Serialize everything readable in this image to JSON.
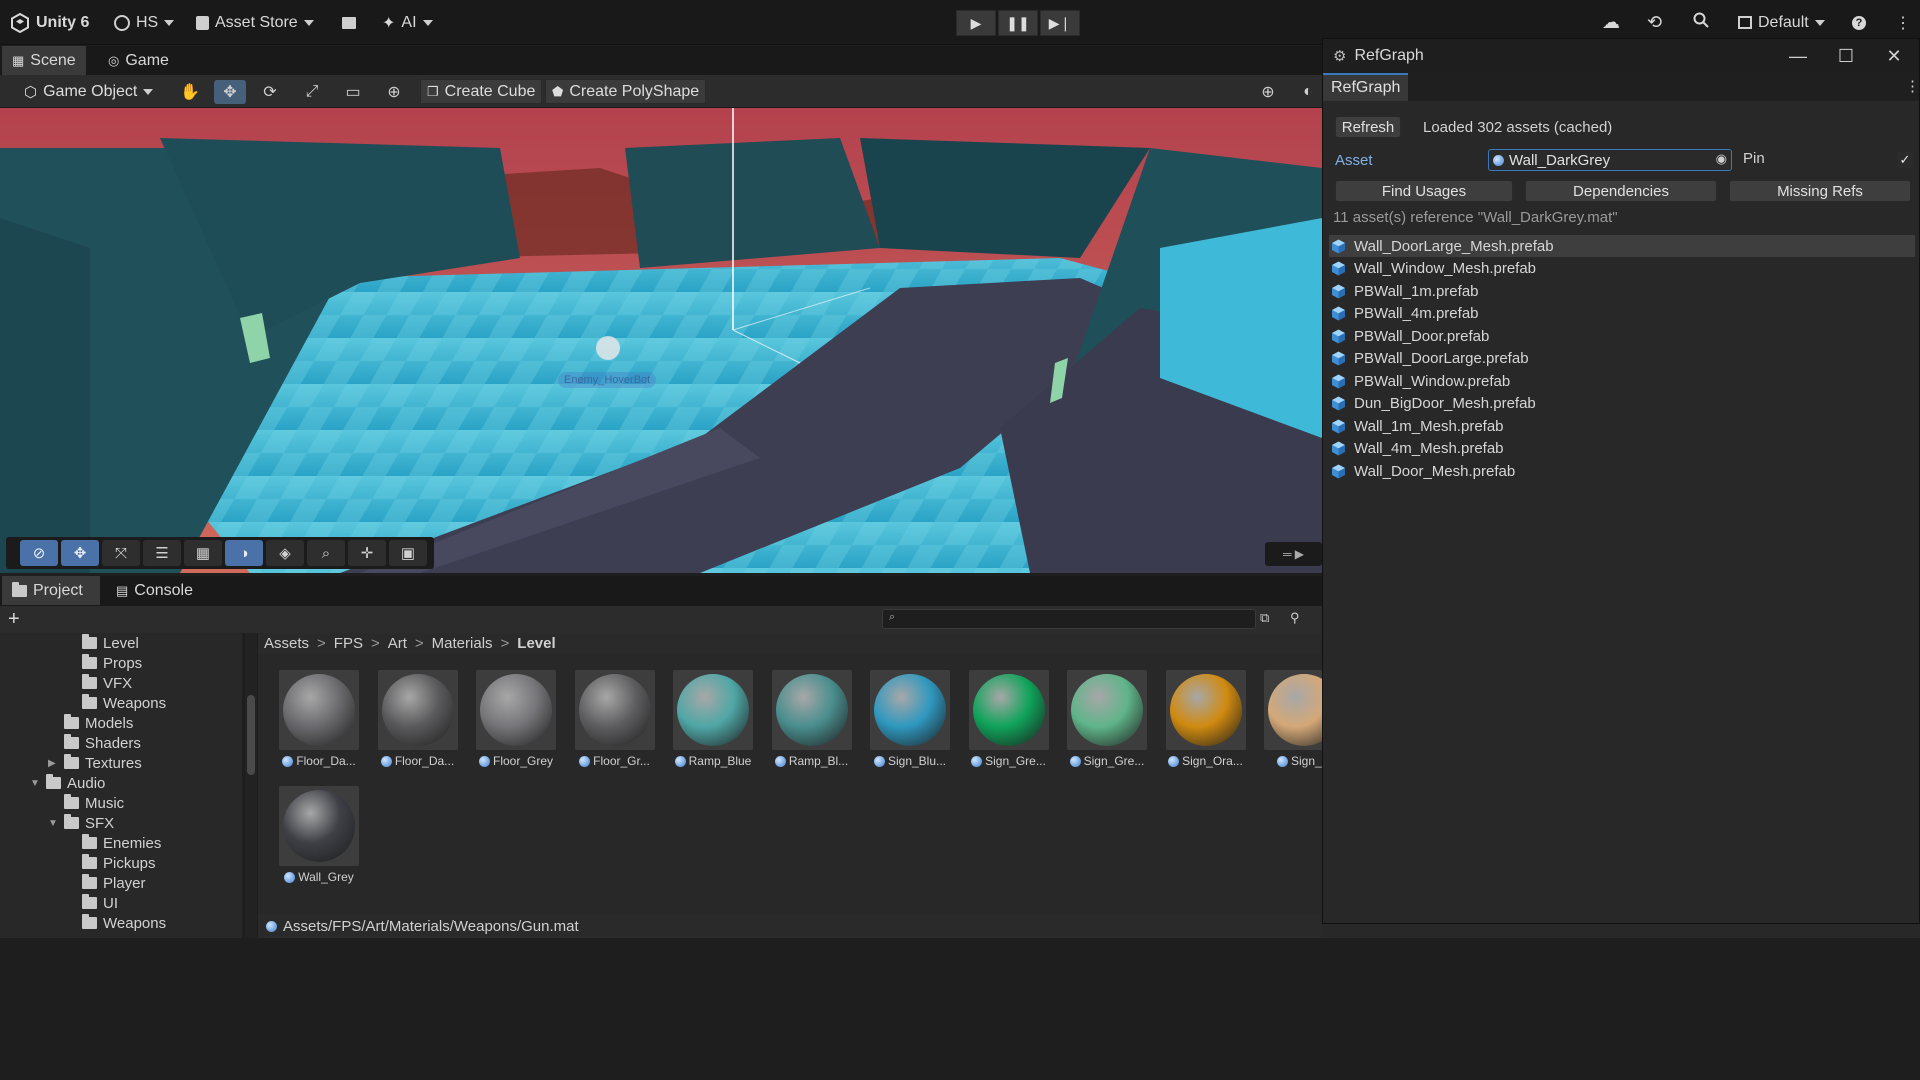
{
  "topbar": {
    "app_label": "Unity 6",
    "account_label": "HS",
    "store_label": "Asset Store",
    "ai_label": "AI",
    "layout_label": "Default"
  },
  "scene": {
    "tabs": [
      {
        "label": "Scene"
      },
      {
        "label": "Game"
      }
    ],
    "object_mode_label": "Game Object",
    "create_cube_label": "Create Cube",
    "create_polyshape_label": "Create PolyShape",
    "selected_object_label": "Enemy_HoverBot"
  },
  "project": {
    "tabs": [
      {
        "label": "Project"
      },
      {
        "label": "Console"
      }
    ],
    "add_label": "+",
    "tree": [
      {
        "label": "Level",
        "indent": 3,
        "expanded": null
      },
      {
        "label": "Props",
        "indent": 3,
        "expanded": null
      },
      {
        "label": "VFX",
        "indent": 3,
        "expanded": null
      },
      {
        "label": "Weapons",
        "indent": 3,
        "expanded": null
      },
      {
        "label": "Models",
        "indent": 2,
        "expanded": null
      },
      {
        "label": "Shaders",
        "indent": 2,
        "expanded": null
      },
      {
        "label": "Textures",
        "indent": 2,
        "expanded": false
      },
      {
        "label": "Audio",
        "indent": 1,
        "expanded": true
      },
      {
        "label": "Music",
        "indent": 2,
        "expanded": null
      },
      {
        "label": "SFX",
        "indent": 2,
        "expanded": true
      },
      {
        "label": "Enemies",
        "indent": 3,
        "expanded": null
      },
      {
        "label": "Pickups",
        "indent": 3,
        "expanded": null
      },
      {
        "label": "Player",
        "indent": 3,
        "expanded": null
      },
      {
        "label": "UI",
        "indent": 3,
        "expanded": null
      },
      {
        "label": "Weapons",
        "indent": 3,
        "expanded": null
      }
    ],
    "breadcrumb": [
      "Assets",
      "FPS",
      "Art",
      "Materials",
      "Level"
    ],
    "materials": [
      {
        "label": "Floor_Da...",
        "color": "#6a6a6e"
      },
      {
        "label": "Floor_Da...",
        "color": "#5a5a5c"
      },
      {
        "label": "Floor_Grey",
        "color": "#76767a"
      },
      {
        "label": "Floor_Gr...",
        "color": "#5e5e60"
      },
      {
        "label": "Ramp_Blue",
        "color": "#4fa7a6"
      },
      {
        "label": "Ramp_Bl...",
        "color": "#4a8e8e"
      },
      {
        "label": "Sign_Blu...",
        "color": "#2f98bf"
      },
      {
        "label": "Sign_Gre...",
        "color": "#0fa35a"
      },
      {
        "label": "Sign_Gre...",
        "color": "#5fb48a"
      },
      {
        "label": "Sign_Ora...",
        "color": "#d08a10"
      },
      {
        "label": "Sign_O",
        "color": "#d4a878"
      },
      {
        "label": "Wall_Grey",
        "color": "#3e4046"
      }
    ],
    "status_path": "Assets/FPS/Art/Materials/Weapons/Gun.mat"
  },
  "refgraph": {
    "window_title": "RefGraph",
    "tab_label": "RefGraph",
    "refresh_label": "Refresh",
    "loaded_text": "Loaded 302 assets (cached)",
    "asset_label": "Asset",
    "asset_value": "Wall_DarkGrey",
    "pin_label": "Pin",
    "pin_checked": true,
    "find_usages_label": "Find Usages",
    "dependencies_label": "Dependencies",
    "missing_refs_label": "Missing Refs",
    "summary_text": "11 asset(s) reference \"Wall_DarkGrey.mat\"",
    "results": [
      "Wall_DoorLarge_Mesh.prefab",
      "Wall_Window_Mesh.prefab",
      "PBWall_1m.prefab",
      "PBWall_4m.prefab",
      "PBWall_Door.prefab",
      "PBWall_DoorLarge.prefab",
      "PBWall_Window.prefab",
      "Dun_BigDoor_Mesh.prefab",
      "Wall_1m_Mesh.prefab",
      "Wall_4m_Mesh.prefab",
      "Wall_Door_Mesh.prefab"
    ],
    "selected_result_index": 0
  },
  "colors": {
    "accent": "#3a79bb",
    "sky": "#c0505a",
    "floor": "#3fb6d6",
    "wall": "#21515a"
  }
}
